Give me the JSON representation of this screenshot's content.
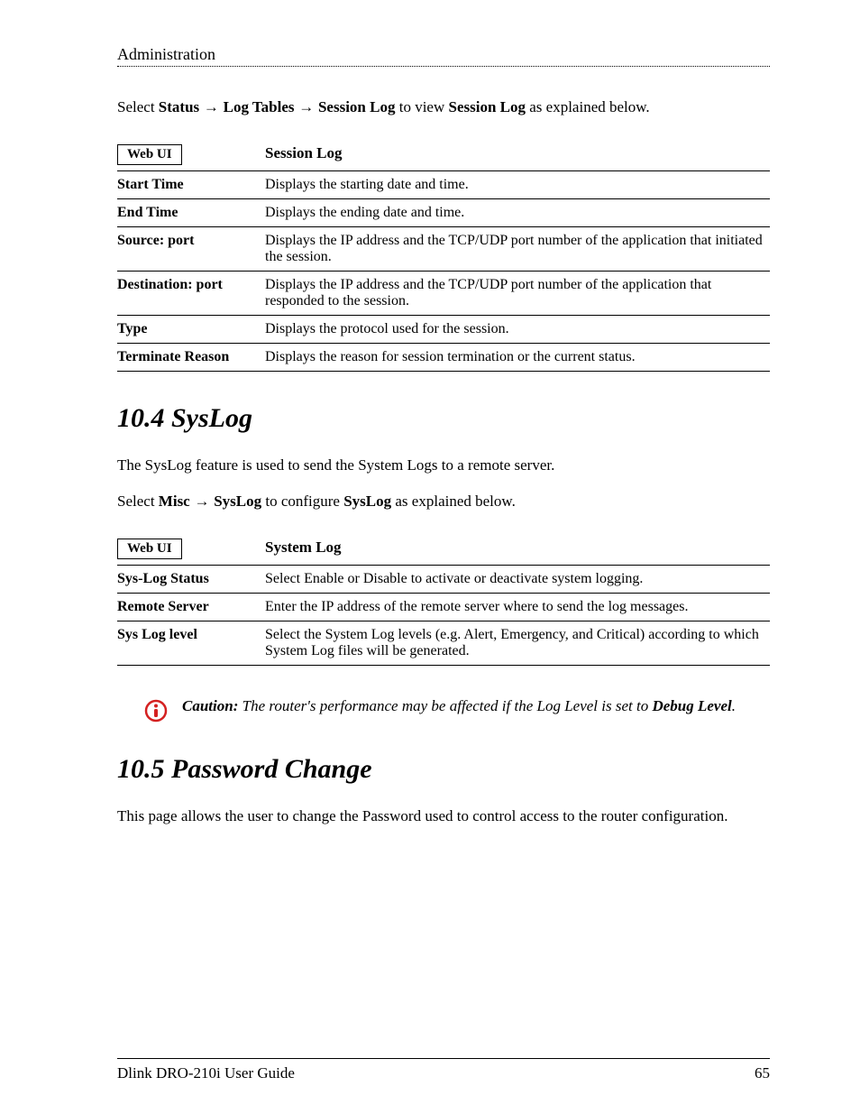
{
  "header": {
    "title": "Administration"
  },
  "intro1": {
    "prefix": "Select ",
    "b1": "Status",
    "arrow1": " → ",
    "b2": "Log Tables",
    "arrow2": " → ",
    "b3": "Session Log",
    "mid": " to view ",
    "b4": "Session Log",
    "suffix": " as explained below."
  },
  "table1": {
    "webui": "Web UI",
    "title": "Session Log",
    "rows": [
      {
        "k": "Start Time",
        "v": "Displays the starting date and time."
      },
      {
        "k": "End Time",
        "v": "Displays the ending date and time."
      },
      {
        "k": "Source: port",
        "v": "Displays the IP address and the TCP/UDP port number of the application that initiated the session."
      },
      {
        "k": "Destination: port",
        "v": "Displays the IP address and the TCP/UDP port number of the application that responded to the session."
      },
      {
        "k": "Type",
        "v": "Displays the protocol used for the session."
      },
      {
        "k": "Terminate Reason",
        "v": "Displays the reason for session termination or the current status."
      }
    ]
  },
  "section1": {
    "heading": "10.4 SysLog"
  },
  "syslog_intro": "The SysLog feature is used to send the System Logs to a remote server.",
  "intro2": {
    "prefix": "Select ",
    "b1": "Misc",
    "arrow1": " → ",
    "b2": "SysLog",
    "mid": " to configure ",
    "b3": "SysLog",
    "suffix": " as explained below."
  },
  "table2": {
    "webui": "Web UI",
    "title": "System Log",
    "rows": [
      {
        "k": "Sys-Log Status",
        "v": "Select Enable or Disable to activate or deactivate system logging."
      },
      {
        "k": "Remote Server",
        "v": "Enter the IP address of the remote server where to send the log messages."
      },
      {
        "k": "Sys Log level",
        "v": "Select the System Log levels (e.g. Alert, Emergency, and Critical) according to which System Log files will be generated."
      }
    ]
  },
  "caution": {
    "label": "Caution:",
    "t1": " The router's performance may be affected if the Log Level is set to ",
    "b1": "Debug Level",
    "t2": "."
  },
  "section2": {
    "heading": "10.5 Password Change"
  },
  "pwd_intro": "This page allows the user to change the Password used to control access to the router configuration.",
  "footer": {
    "left": "Dlink DRO-210i User Guide",
    "right": "65"
  }
}
